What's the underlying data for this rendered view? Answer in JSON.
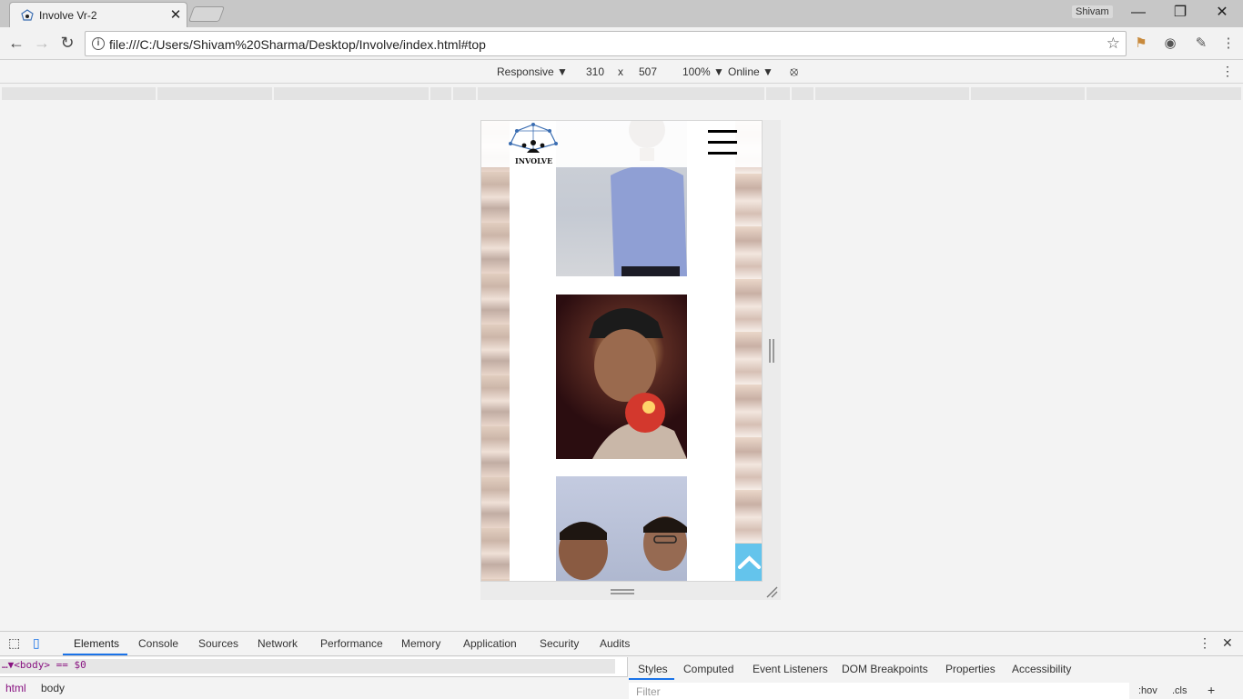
{
  "browser": {
    "tab_title": "Involve Vr-2",
    "tab_close": "✕",
    "user": "Shivam",
    "url": "file:///C:/Users/Shivam%20Sharma/Desktop/Involve/index.html#top"
  },
  "device_toolbar": {
    "mode": "Responsive ▼",
    "width": "310",
    "times": "x",
    "height": "507",
    "zoom": "100% ▼",
    "network": "Online ▼"
  },
  "site": {
    "logo_text": "INVOLVE",
    "accent_color": "#64c4ec"
  },
  "devtools": {
    "tabs": [
      "Elements",
      "Console",
      "Sources",
      "Network",
      "Performance",
      "Memory",
      "Application",
      "Security",
      "Audits"
    ],
    "dom_line": "…▼<body> == $0",
    "breadcrumbs": [
      "html",
      "body"
    ],
    "style_tabs": [
      "Styles",
      "Computed",
      "Event Listeners",
      "DOM Breakpoints",
      "Properties",
      "Accessibility"
    ],
    "filter_placeholder": "Filter",
    "hov": ":hov",
    "cls": ".cls",
    "plus": "+"
  }
}
